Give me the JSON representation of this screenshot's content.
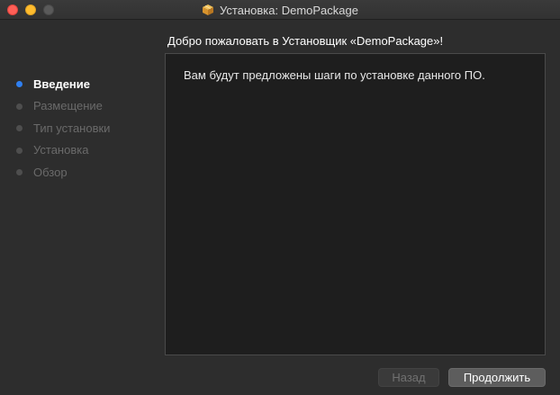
{
  "window": {
    "title": "Установка: DemoPackage",
    "icon": "package-icon"
  },
  "header": {
    "welcome": "Добро пожаловать в Установщик «DemoPackage»!"
  },
  "sidebar": {
    "steps": [
      {
        "label": "Введение",
        "active": true
      },
      {
        "label": "Размещение",
        "active": false
      },
      {
        "label": "Тип установки",
        "active": false
      },
      {
        "label": "Установка",
        "active": false
      },
      {
        "label": "Обзор",
        "active": false
      }
    ]
  },
  "main": {
    "text": "Вам будут предложены шаги по установке данного ПО."
  },
  "buttons": {
    "back_label": "Назад",
    "continue_label": "Продолжить"
  },
  "colors": {
    "active_step_dot": "#2f7ff0",
    "close": "#fe5f57",
    "minimize": "#febc2e",
    "zoom_disabled": "#5a5a5a"
  }
}
